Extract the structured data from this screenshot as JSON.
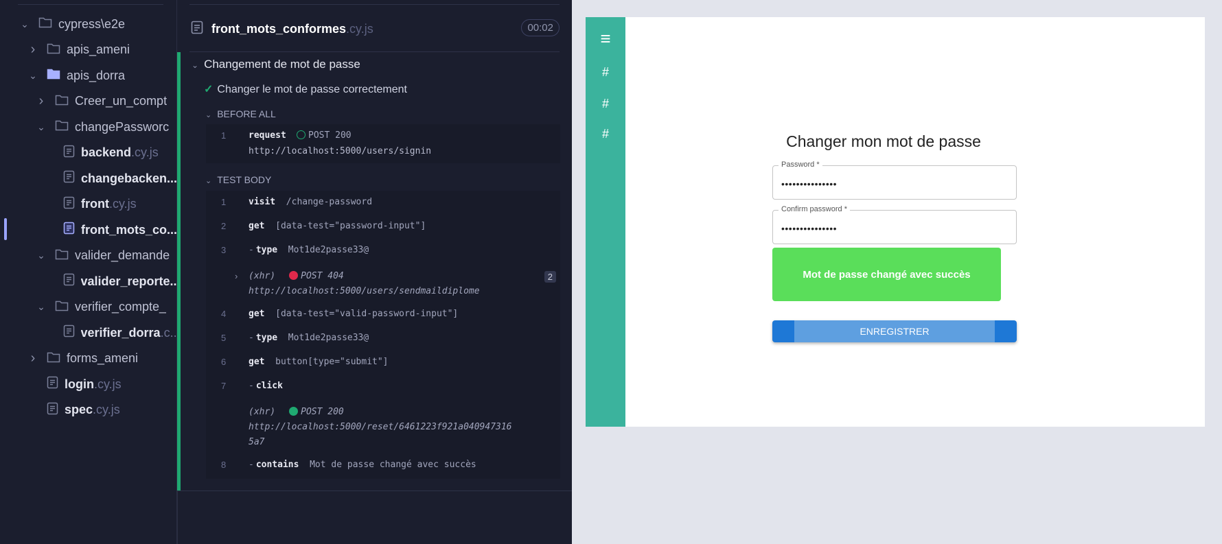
{
  "specs_tree": {
    "items": [
      {
        "type": "folder",
        "label": "cypress\\e2e",
        "state": "open",
        "depth": 0
      },
      {
        "type": "folder",
        "label": "apis_ameni",
        "state": "closed",
        "depth": 1
      },
      {
        "type": "folder",
        "label": "apis_dorra",
        "state": "open",
        "depth": 1
      },
      {
        "type": "folder",
        "label": "Creer_un_compt",
        "state": "closed",
        "depth": 2
      },
      {
        "type": "folder",
        "label": "changePassworc",
        "state": "open",
        "depth": 2
      },
      {
        "type": "file",
        "label": "backend",
        "ext": ".cy.js",
        "depth": 3
      },
      {
        "type": "file",
        "label": "changebacken...",
        "ext": "",
        "depth": 3
      },
      {
        "type": "file",
        "label": "front",
        "ext": ".cy.js",
        "depth": 3
      },
      {
        "type": "file",
        "label": "front_mots_co...",
        "ext": "",
        "depth": 3,
        "selected": true
      },
      {
        "type": "folder",
        "label": "valider_demandе",
        "state": "open",
        "depth": 2
      },
      {
        "type": "file",
        "label": "valider_reporte...",
        "ext": "",
        "depth": 3
      },
      {
        "type": "folder",
        "label": "verifier_compte_",
        "state": "open",
        "depth": 2
      },
      {
        "type": "file",
        "label": "verifier_dorra",
        "ext": ".c...",
        "depth": 3
      },
      {
        "type": "folder",
        "label": "forms_ameni",
        "state": "closed",
        "depth": 1
      },
      {
        "type": "file",
        "label": "login",
        "ext": ".cy.js",
        "depth": 1
      },
      {
        "type": "file",
        "label": "spec",
        "ext": ".cy.js",
        "depth": 1
      }
    ]
  },
  "reporter": {
    "spec_name": "front_mots_conformes",
    "spec_ext": ".cy.js",
    "duration": "00:02",
    "suite_title": "Changement de mot de passe",
    "test_title": "Changer le mot de passe correctement",
    "before_all_label": "BEFORE ALL",
    "test_body_label": "TEST BODY",
    "before_all": [
      {
        "num": "1",
        "name": "request",
        "status": "POST 200",
        "url": "http://localhost:5000/users/signin"
      }
    ],
    "body": [
      {
        "num": "1",
        "name": "visit",
        "message": "/change-password"
      },
      {
        "num": "2",
        "name": "get",
        "message": "[data-test=\"password-input\"]"
      },
      {
        "num": "3",
        "name": "type",
        "message": "Mot1de2passe33@"
      },
      {
        "xhr": "(xhr)",
        "status": "POST 404",
        "url": "http://localhost:5000/users/sendmaildiplome",
        "count": "2"
      },
      {
        "num": "4",
        "name": "get",
        "message": "[data-test=\"valid-password-input\"]"
      },
      {
        "num": "5",
        "name": "type",
        "message": "Mot1de2passe33@"
      },
      {
        "num": "6",
        "name": "get",
        "message": "button[type=\"submit\"]"
      },
      {
        "num": "7",
        "name": "click",
        "message": ""
      },
      {
        "xhr": "(xhr)",
        "status": "POST 200",
        "url_line1": "http://localhost:5000/reset/6461223f921a040947316",
        "url_line2": "5a7"
      },
      {
        "num": "8",
        "name": "contains",
        "message": "Mot de passe changé avec succès"
      }
    ]
  },
  "app": {
    "nav_icons": [
      "menu-icon",
      "hash-icon",
      "hash-icon",
      "hash-icon"
    ],
    "nav_glyphs": {
      "menu": "≡",
      "hash": "#"
    },
    "form_title": "Changer mon mot de passe",
    "password_label": "Password *",
    "password_value": "•••••••••••••••",
    "confirm_label": "Confirm password *",
    "confirm_value": "•••••••••••••••",
    "toast": "Mot de passe changé avec succès",
    "submit_label": "ENREGISTRER"
  },
  "colors": {
    "success": "#1fa971",
    "failure": "#e0294b",
    "app_nav": "#3bb39d",
    "toast": "#5ade5a",
    "button": "#1e78d6"
  }
}
